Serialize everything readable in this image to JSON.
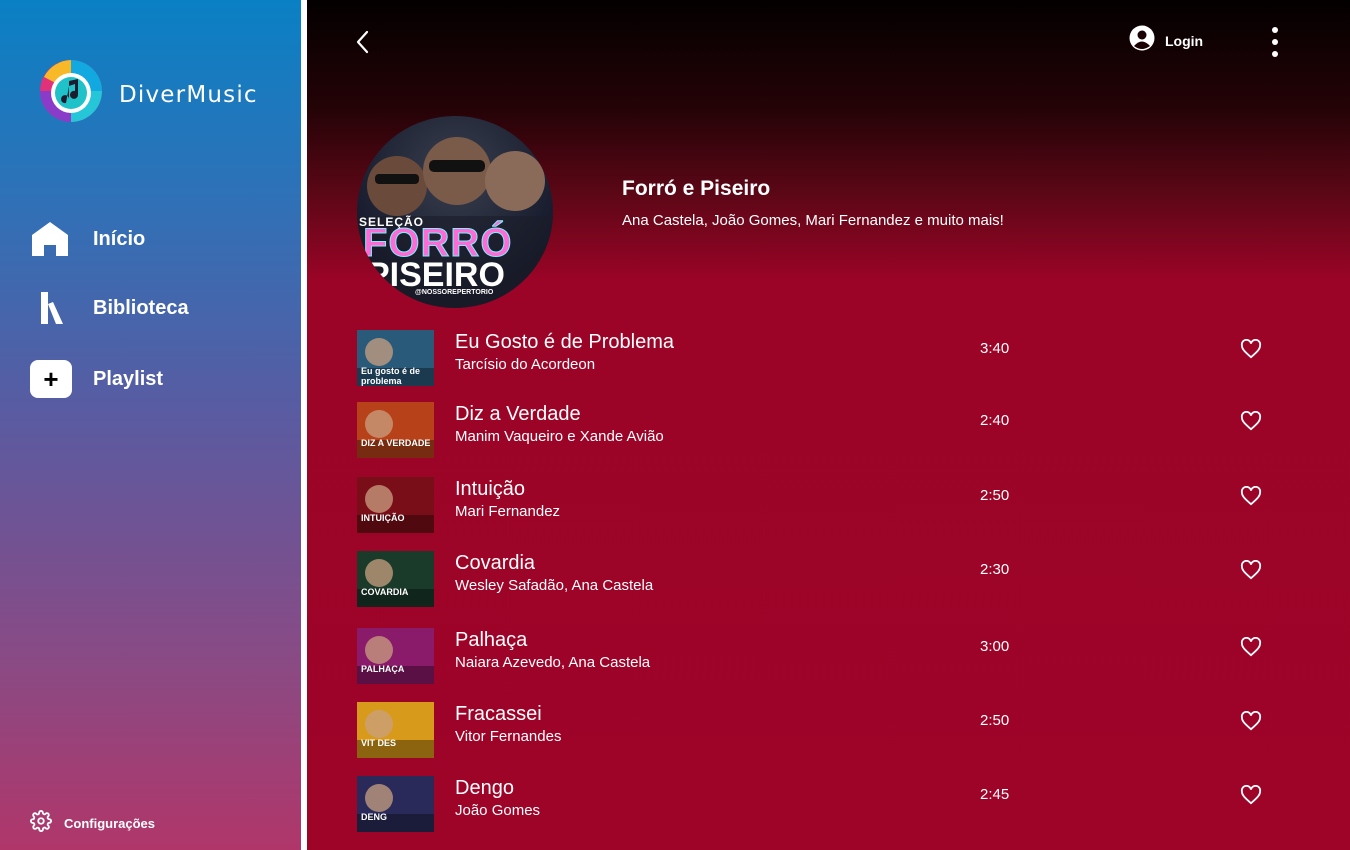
{
  "app": {
    "brand": "DiverMusic"
  },
  "sidebar": {
    "items": [
      {
        "label": "Início",
        "icon": "home-icon"
      },
      {
        "label": "Biblioteca",
        "icon": "library-icon"
      },
      {
        "label": "Playlist",
        "icon": "plus-icon"
      }
    ],
    "settings_label": "Configurações"
  },
  "header": {
    "login_label": "Login"
  },
  "playlist": {
    "cover_text": {
      "selection": "SELEÇÃO",
      "line1": "FORRÓ",
      "line2": "PISEIRO",
      "tag": "@NOSSOREPERTORIO"
    },
    "title": "Forró e Piseiro",
    "subtitle": "Ana Castela, João Gomes, Mari Fernandez e muito mais!"
  },
  "tracks": [
    {
      "title": "Eu Gosto é de Problema",
      "artist": "Tarcísio do Acordeon",
      "duration": "3:40",
      "thumb_text": "Eu gosto é de problema",
      "thumb_color": "#2a5a7a"
    },
    {
      "title": "Diz a Verdade",
      "artist": "Manim Vaqueiro  e Xande Avião",
      "duration": "2:40",
      "thumb_text": "DIZ A VERDADE",
      "thumb_color": "#b7421a"
    },
    {
      "title": "Intuição",
      "artist": "Mari Fernandez",
      "duration": "2:50",
      "thumb_text": "INTUIÇÃO",
      "thumb_color": "#7a0e18"
    },
    {
      "title": "Covardia",
      "artist": "Wesley Safadão, Ana Castela",
      "duration": "2:30",
      "thumb_text": "COVARDIA",
      "thumb_color": "#1a3a2a"
    },
    {
      "title": "Palhaça",
      "artist": "Naiara Azevedo, Ana Castela",
      "duration": "3:00",
      "thumb_text": "PALHAÇA",
      "thumb_color": "#8a1a6a"
    },
    {
      "title": "Fracassei",
      "artist": "Vitor Fernandes",
      "duration": "2:50",
      "thumb_text": "VIT DES",
      "thumb_color": "#d89a1a"
    },
    {
      "title": "Dengo",
      "artist": "João Gomes",
      "duration": "2:45",
      "thumb_text": "DENG",
      "thumb_color": "#2a2a5a"
    }
  ],
  "colors": {
    "sidebar_top": "#0a80c4",
    "sidebar_bottom": "#b0366a",
    "main_bg": "#9e0328",
    "text": "#ffffff"
  }
}
